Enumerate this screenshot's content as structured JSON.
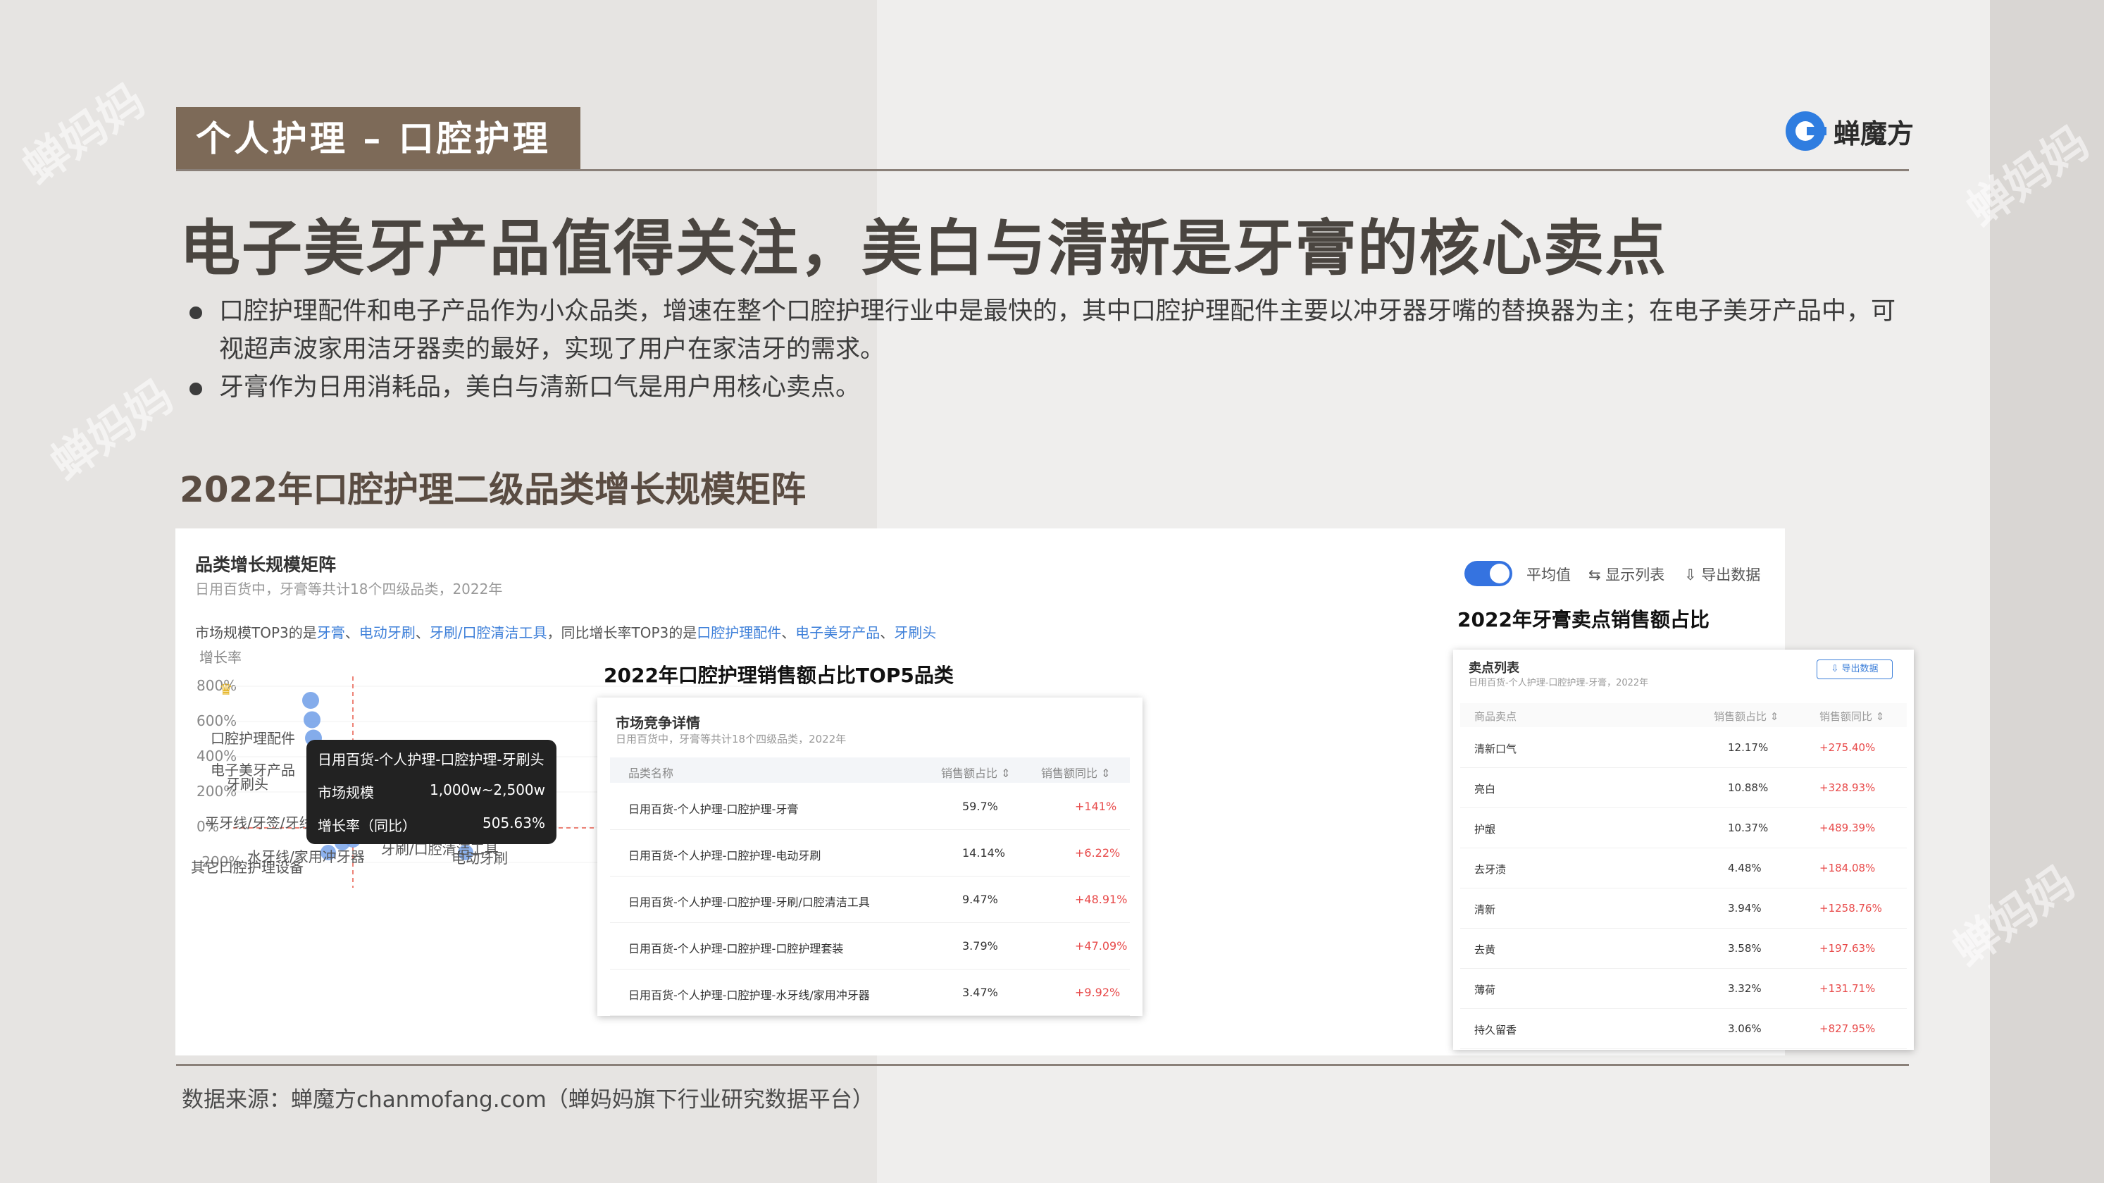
{
  "header": {
    "tag": "个人护理 – 口腔护理",
    "logo_text": "蝉魔方"
  },
  "headline": "电子美牙产品值得关注，美白与清新是牙膏的核心卖点",
  "bullets": [
    "口腔护理配件和电子产品作为小众品类，增速在整个口腔护理行业中是最快的，其中口腔护理配件主要以冲牙器牙嘴的替换器为主；在电子美牙产品中，可视超声波家用洁牙器卖的最好，实现了用户在家洁牙的需求。",
    "牙膏作为日用消耗品，美白与清新口气是用户用核心卖点。"
  ],
  "section_title": "2022年口腔护理二级品类增长规模矩阵",
  "watermark": "蝉妈妈",
  "matrix": {
    "title": "品类增长规模矩阵",
    "subtitle": "日用百货中，牙膏等共计18个四级品类，2022年",
    "desc_prefix": "市场规模TOP3的是",
    "size_top3": [
      "牙膏",
      "电动牙刷",
      "牙刷/口腔清洁工具"
    ],
    "desc_mid": "，同比增长率TOP3的是",
    "growth_top3": [
      "口腔护理配件",
      "电子美牙产品",
      "牙刷头"
    ],
    "toggle_label": "平均值",
    "list_label": "⇆ 显示列表",
    "export_label": "⇩ 导出数据",
    "tooltip": {
      "title": "日用百货-个人护理-口腔护理-牙刷头",
      "rows": [
        {
          "k": "市场规模",
          "v": "1,000w~2,500w"
        },
        {
          "k": "增长率（同比）",
          "v": "505.63%"
        }
      ]
    }
  },
  "chart_data": {
    "type": "scatter",
    "ylabel": "增长率",
    "yticks": [
      "800%",
      "600%",
      "400%",
      "200%",
      "0%",
      "-200%"
    ],
    "labels": [
      "口腔护理配件",
      "电子美牙产品",
      "牙刷头",
      "平牙线/牙签/牙线棒",
      "水牙线/家用冲牙器",
      "牙刷/口腔清洁工具",
      "电动牙刷",
      "其它口腔护理设备"
    ],
    "average_line_label": "平均值",
    "series": [
      {
        "name": "",
        "y": [
          720,
          610,
          506,
          350,
          100,
          80,
          110
        ]
      }
    ]
  },
  "mid_table": {
    "heading": "2022年口腔护理销售额占比TOP5品类",
    "title": "市场竞争详情",
    "subtitle": "日用百货中，牙膏等共计18个四级品类，2022年",
    "columns": [
      "品类名称",
      "销售额占比 ⇕",
      "销售额同比 ⇕"
    ],
    "rows": [
      {
        "name": "日用百货-个人护理-口腔护理-牙膏",
        "share": "59.7%",
        "yoy": "+141%"
      },
      {
        "name": "日用百货-个人护理-口腔护理-电动牙刷",
        "share": "14.14%",
        "yoy": "+6.22%"
      },
      {
        "name": "日用百货-个人护理-口腔护理-牙刷/口腔清洁工具",
        "share": "9.47%",
        "yoy": "+48.91%"
      },
      {
        "name": "日用百货-个人护理-口腔护理-口腔护理套装",
        "share": "3.79%",
        "yoy": "+47.09%"
      },
      {
        "name": "日用百货-个人护理-口腔护理-水牙线/家用冲牙器",
        "share": "3.47%",
        "yoy": "+9.92%"
      }
    ]
  },
  "right_table": {
    "heading": "2022年牙膏卖点销售额占比",
    "title": "卖点列表",
    "subtitle": "日用百货-个人护理-口腔护理-牙膏，2022年",
    "export": "⇩ 导出数据",
    "columns": [
      "商品卖点",
      "销售额占比 ⇕",
      "销售额同比 ⇕"
    ],
    "rows": [
      {
        "name": "清新口气",
        "share": "12.17%",
        "yoy": "+275.40%"
      },
      {
        "name": "亮白",
        "share": "10.88%",
        "yoy": "+328.93%"
      },
      {
        "name": "护龈",
        "share": "10.37%",
        "yoy": "+489.39%"
      },
      {
        "name": "去牙渍",
        "share": "4.48%",
        "yoy": "+184.08%"
      },
      {
        "name": "清新",
        "share": "3.94%",
        "yoy": "+1258.76%"
      },
      {
        "name": "去黄",
        "share": "3.58%",
        "yoy": "+197.63%"
      },
      {
        "name": "薄荷",
        "share": "3.32%",
        "yoy": "+131.71%"
      },
      {
        "name": "持久留香",
        "share": "3.06%",
        "yoy": "+827.95%"
      }
    ]
  },
  "footer": "数据来源：蝉魔方chanmofang.com（蝉妈妈旗下行业研究数据平台）",
  "colors": {
    "brand": "#7d6a58",
    "accent": "#3573e0",
    "positive": "#e84a4a"
  }
}
